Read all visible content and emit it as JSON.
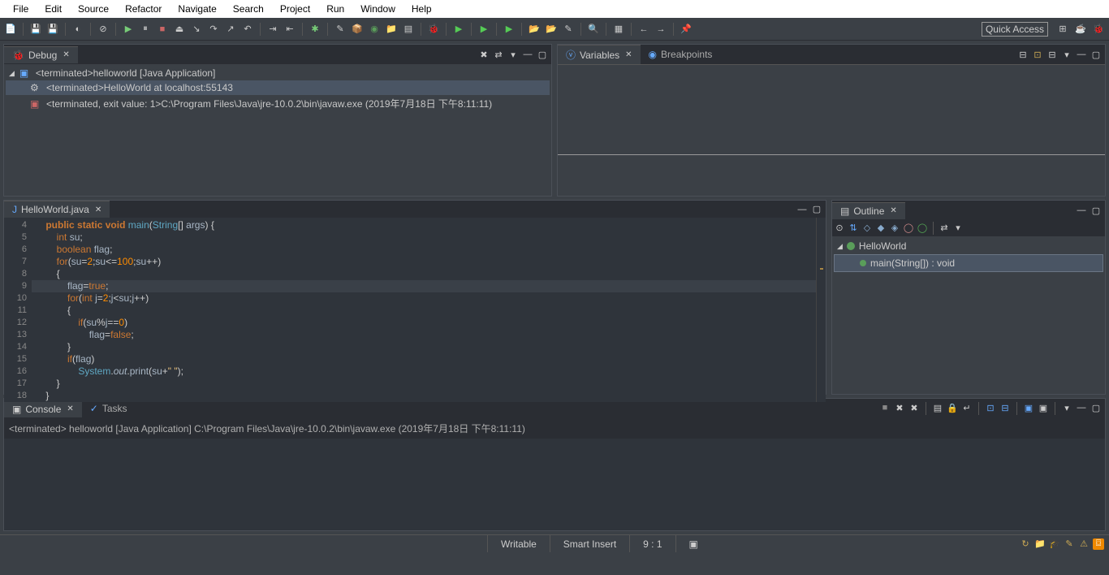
{
  "menu": [
    "File",
    "Edit",
    "Source",
    "Refactor",
    "Navigate",
    "Search",
    "Project",
    "Run",
    "Window",
    "Help"
  ],
  "quick_access": "Quick Access",
  "debug": {
    "tab": "Debug",
    "rows": [
      {
        "text": "<terminated>helloworld [Java Application]",
        "icon": "java-app"
      },
      {
        "text": "<terminated>HelloWorld at localhost:55143",
        "icon": "gear"
      },
      {
        "text": "<terminated, exit value: 1>C:\\Program Files\\Java\\jre-10.0.2\\bin\\javaw.exe (2019年7月18日 下午8:11:11)",
        "icon": "term"
      }
    ]
  },
  "vars": {
    "tab_variables": "Variables",
    "tab_breakpoints": "Breakpoints"
  },
  "editor": {
    "tab": "HelloWorld.java",
    "lines": [
      {
        "n": 4,
        "html": "    <span class='kw'>public</span> <span class='kw'>static</span> <span class='kw'>void</span> <span class='fn'>main</span>(<span class='type'>String</span>[] <span class='id'>args</span>) {"
      },
      {
        "n": 5,
        "html": "        <span class='kw2'>int</span> <span class='id'>su</span>;"
      },
      {
        "n": 6,
        "html": "        <span class='kw2'>boolean</span> <span class='id'>flag</span>;"
      },
      {
        "n": 7,
        "html": "        <span class='kw2'>for</span>(<span class='id'>su</span>=<span class='num'>2</span>;<span class='id'>su</span>&lt;=<span class='num'>100</span>;<span class='id'>su</span>++)"
      },
      {
        "n": 8,
        "html": "        {"
      },
      {
        "n": 9,
        "html": "            <span class='id'>flag</span>=<span class='val'>true</span>;",
        "hl": true
      },
      {
        "n": 10,
        "html": "            <span class='kw2'>for</span>(<span class='kw2'>int</span> <span class='id'>j</span>=<span class='num'>2</span>;<span class='id'>j</span>&lt;<span class='id'>su</span>;<span class='id'>j</span>++)"
      },
      {
        "n": 11,
        "html": "            {"
      },
      {
        "n": 12,
        "html": "                <span class='kw2'>if</span>(<span class='id'>su</span>%<span class='id'>j</span>==<span class='num'>0</span>)"
      },
      {
        "n": 13,
        "html": "                    <span class='id'>flag</span>=<span class='val'>false</span>;"
      },
      {
        "n": 14,
        "html": "            }"
      },
      {
        "n": 15,
        "html": "            <span class='kw2'>if</span>(<span class='id'>flag</span>)"
      },
      {
        "n": 16,
        "html": "                <span class='type'>System</span>.<span class='id' style='font-style:italic'>out</span>.<span class='id'>print</span>(<span class='id'>su</span>+<span class='str'>\" \"</span>);"
      },
      {
        "n": 17,
        "html": "        }"
      },
      {
        "n": 18,
        "html": "    }"
      }
    ]
  },
  "outline": {
    "tab": "Outline",
    "class": "HelloWorld",
    "method": "main(String[]) : void"
  },
  "console": {
    "tab_console": "Console",
    "tab_tasks": "Tasks",
    "line": "<terminated> helloworld [Java Application] C:\\Program Files\\Java\\jre-10.0.2\\bin\\javaw.exe (2019年7月18日 下午8:11:11)"
  },
  "status": {
    "writable": "Writable",
    "insert": "Smart Insert",
    "pos": "9 : 1"
  }
}
